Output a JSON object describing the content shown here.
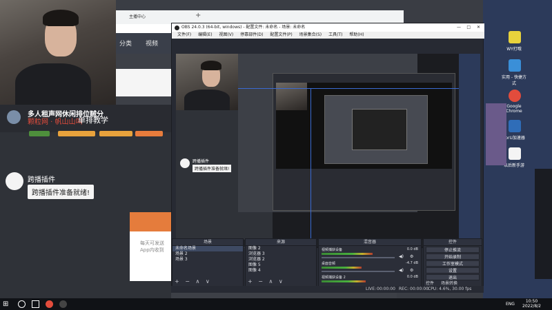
{
  "browser": {
    "tab_title": "主播中心",
    "nav": [
      "分类",
      "视频"
    ]
  },
  "stream_overlay": {
    "title": "多人租声网休闲排位贼分",
    "subtitle": "颗粒网 · 帆山山叫",
    "cta": "单排教学",
    "chat": {
      "name": "跨播插件",
      "message": "跨播插件准备就绪!"
    },
    "promo_text": [
      "每天可发送",
      "App内收到"
    ]
  },
  "obs": {
    "window_title": "OBS 24.0.3 (64-bit, windows) - 配置文件: 未命名 - 场景: 未命名",
    "menu": [
      "文件(F)",
      "编辑(E)",
      "视图(V)",
      "停靠部件(D)",
      "配置文件(P)",
      "场景集合(S)",
      "工具(T)",
      "帮助(H)"
    ],
    "scenes": {
      "header": "场景",
      "items": [
        "未命名场景",
        "场景 2",
        "场景 3"
      ]
    },
    "sources": {
      "header": "来源",
      "items": [
        "图像 2",
        "浏览器 3",
        "浏览器 2",
        "图像 5",
        "图像 4"
      ]
    },
    "mixer": {
      "header": "混音器",
      "channels": [
        {
          "name": "视频捕获设备",
          "db": "0.0 dB",
          "level": 0.7
        },
        {
          "name": "桌面音频",
          "db": "-4.7 dB",
          "level": 0.55
        },
        {
          "name": "视频捕获设备 2",
          "db": "0.0 dB",
          "level": 0.6
        }
      ]
    },
    "controls": {
      "header": "控件",
      "buttons": [
        "停止推流",
        "开始录制",
        "工作室模式",
        "设置",
        "退出"
      ]
    },
    "bottom_tabs": [
      "控件",
      "场景转换"
    ],
    "dock_buttons": "+ − ∧ ∨",
    "status": {
      "live_label": "LIVE:",
      "live_time": "00:00:00",
      "rec_label": "REC:",
      "rec_time": "00:00:00",
      "cpu": "CPU: 4.6%, 30.00 fps"
    }
  },
  "desktop_icons": [
    {
      "label": "WY打哦",
      "color": "#e8d23c"
    },
    {
      "label": "实用 - 快捷方式",
      "color": "#3a8fd8"
    },
    {
      "label": "Google Chrome",
      "color": "#e24c3c"
    },
    {
      "label": "ForU加速器",
      "color": "#2f6db8"
    },
    {
      "label": "以后新手游",
      "color": "#f4f4f4"
    }
  ],
  "taskbar": {
    "lang": "ENG",
    "time": "10:50",
    "date": "2022/8/2"
  }
}
